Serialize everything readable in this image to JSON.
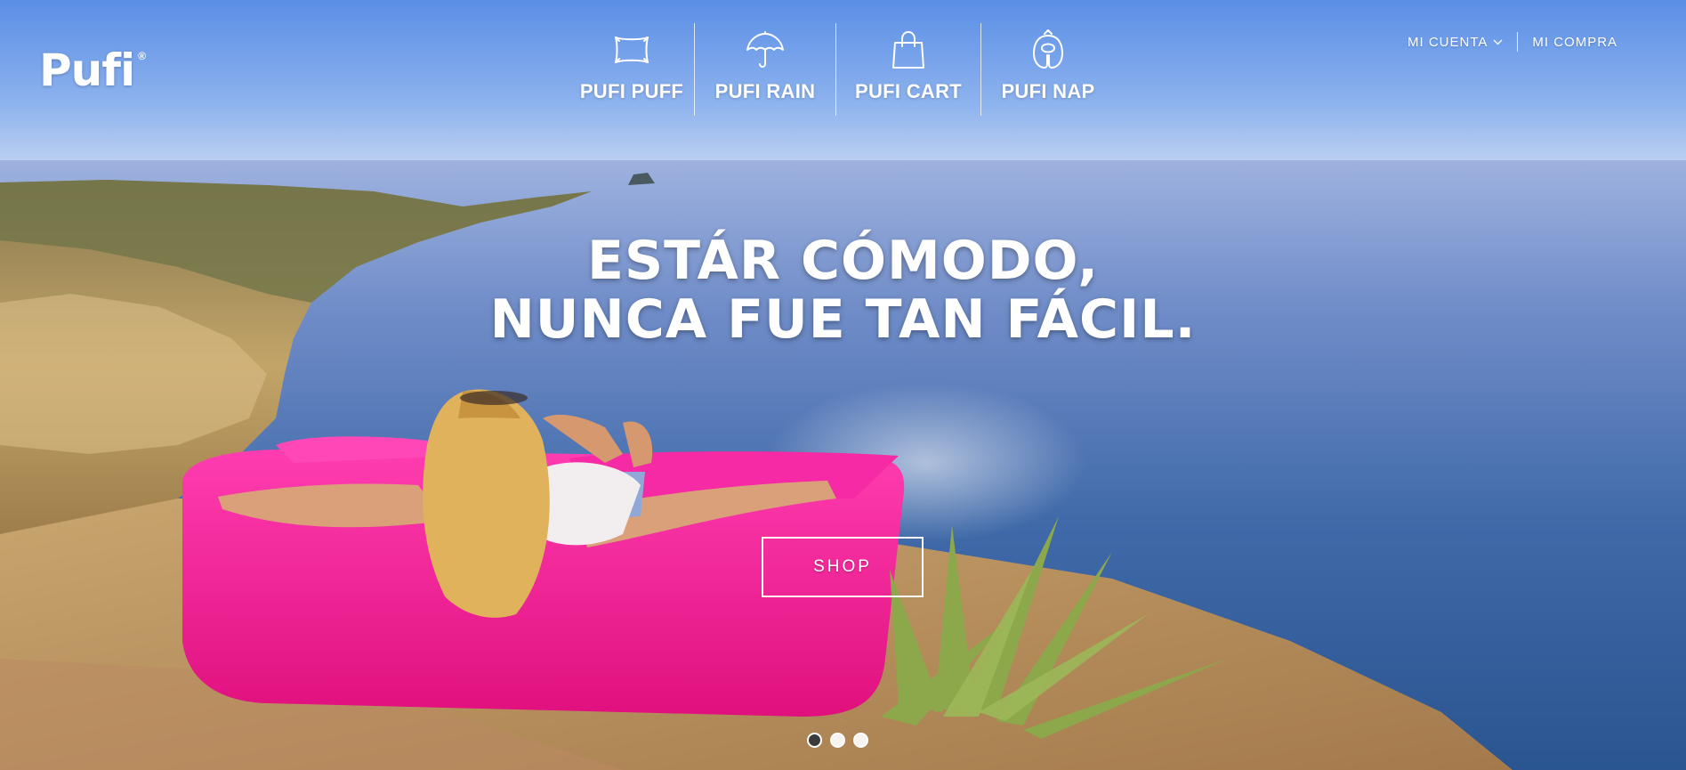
{
  "brand": {
    "logo_text": "Pufi",
    "registered_mark": "®"
  },
  "main_nav": [
    {
      "label": "PUFI PUFF",
      "icon": "pillow-icon"
    },
    {
      "label": "PUFI RAIN",
      "icon": "umbrella-icon"
    },
    {
      "label": "PUFI CART",
      "icon": "shopping-bag-icon"
    },
    {
      "label": "PUFI NAP",
      "icon": "neck-pillow-icon"
    }
  ],
  "account_nav": {
    "account_label": "MI CUENTA",
    "cart_label": "MI COMPRA"
  },
  "hero": {
    "headline_line1": "ESTÁR CÓMODO,",
    "headline_line2": "NUNCA FUE TAN FÁCIL.",
    "cta_label": "SHOP",
    "slides_total": 3,
    "active_slide": 1
  },
  "colors": {
    "sky": "#5b8fe0",
    "sea": "#3a6aa8",
    "lounger_pink": "#ff1f9a",
    "cliff": "#b89a62"
  }
}
